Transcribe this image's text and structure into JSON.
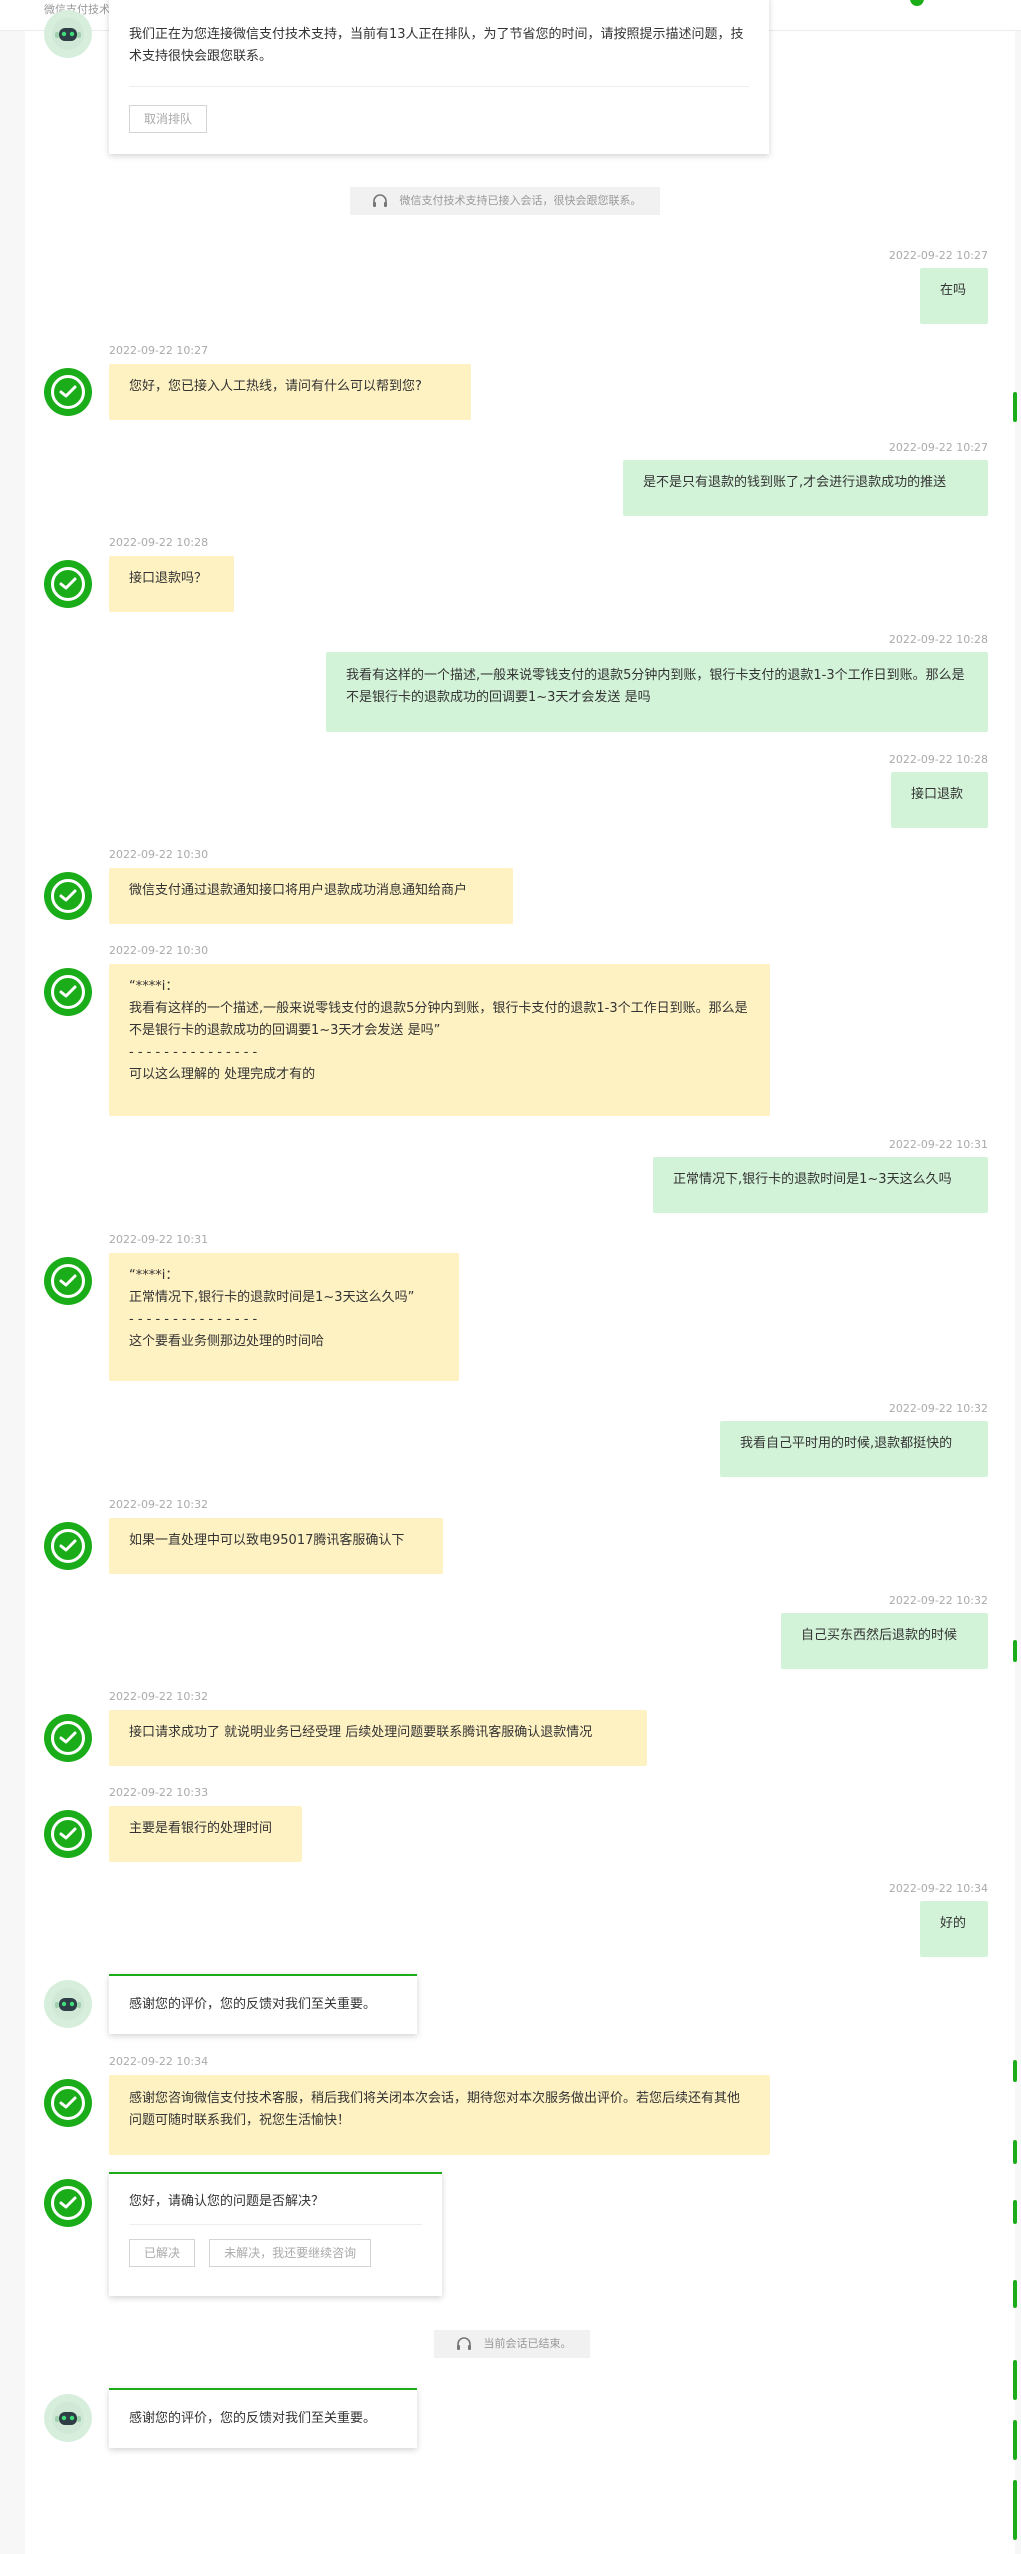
{
  "header": {
    "subtitle": "微信支付技术支持，竭诚为您服务"
  },
  "queue_card": {
    "text": "我们正在为您连接微信支付技术支持，当前有13人正在排队，为了节省您的时间，请按照提示描述问题，技术支持很快会跟您联系。",
    "cancel_label": "取消排队"
  },
  "system_notices": [
    "微信支付技术支持已接入会话，很快会跟您联系。",
    "当前会话已结束。"
  ],
  "messages": [
    {
      "time": "2022-09-22 10:27",
      "text": "在吗"
    },
    {
      "time": "2022-09-22 10:27",
      "text": "您好，您已接入人工热线，请问有什么可以帮到您?"
    },
    {
      "time": "2022-09-22 10:27",
      "text": "是不是只有退款的钱到账了,才会进行退款成功的推送"
    },
    {
      "time": "2022-09-22 10:28",
      "text": "接口退款吗？"
    },
    {
      "time": "2022-09-22 10:28",
      "text": "我看有这样的一个描述,一般来说零钱支付的退款5分钟内到账，银行卡支付的退款1-3个工作日到账。那么是不是银行卡的退款成功的回调要1~3天才会发送 是吗"
    },
    {
      "time": "2022-09-22 10:28",
      "text": "接口退款"
    },
    {
      "time": "2022-09-22 10:30",
      "text": "微信支付通过退款通知接口将用户退款成功消息通知给商户"
    },
    {
      "time": "2022-09-22 10:30",
      "text": "“****i：\n我看有这样的一个描述,一般来说零钱支付的退款5分钟内到账，银行卡支付的退款1-3个工作日到账。那么是不是银行卡的退款成功的回调要1~3天才会发送 是吗”\n- - - - - - - - - - - - - - -\n可以这么理解的 处理完成才有的"
    },
    {
      "time": "2022-09-22 10:31",
      "text": "正常情况下,银行卡的退款时间是1~3天这么久吗"
    },
    {
      "time": "2022-09-22 10:31",
      "text": "“****i：\n正常情况下,银行卡的退款时间是1~3天这么久吗”\n- - - - - - - - - - - - - - -\n这个要看业务侧那边处理的时间哈"
    },
    {
      "time": "2022-09-22 10:32",
      "text": "我看自己平时用的时候,退款都挺快的"
    },
    {
      "time": "2022-09-22 10:32",
      "text": "如果一直处理中可以致电95017腾讯客服确认下"
    },
    {
      "time": "2022-09-22 10:32",
      "text": "自己买东西然后退款的时候"
    },
    {
      "time": "2022-09-22 10:32",
      "text": "接口请求成功了 就说明业务已经受理 后续处理问题要联系腾讯客服确认退款情况"
    },
    {
      "time": "2022-09-22 10:33",
      "text": "主要是看银行的处理时间"
    },
    {
      "time": "2022-09-22 10:34",
      "text": "好的"
    },
    {
      "time": "2022-09-22 10:34",
      "text": "感谢您咨询微信支付技术客服，稍后我们将关闭本次会话，期待您对本次服务做出评价。若您后续还有其他问题可随时联系我们，祝您生活愉快！"
    }
  ],
  "feedback_thanks": "感谢您的评价，您的反馈对我们至关重要。",
  "resolve_card": {
    "question": "您好，请确认您的问题是否解决？",
    "resolved_label": "已解决",
    "unresolved_label": "未解决，我还要继续咨询"
  },
  "colors": {
    "brand_green": "#1aad19",
    "agent_bubble": "#fef1c2",
    "user_bubble": "#d3f3d8"
  },
  "icons": {
    "agent_avatar": "wechat-pay-icon",
    "bot_avatar": "robot-icon",
    "system_notice": "headset-icon"
  }
}
